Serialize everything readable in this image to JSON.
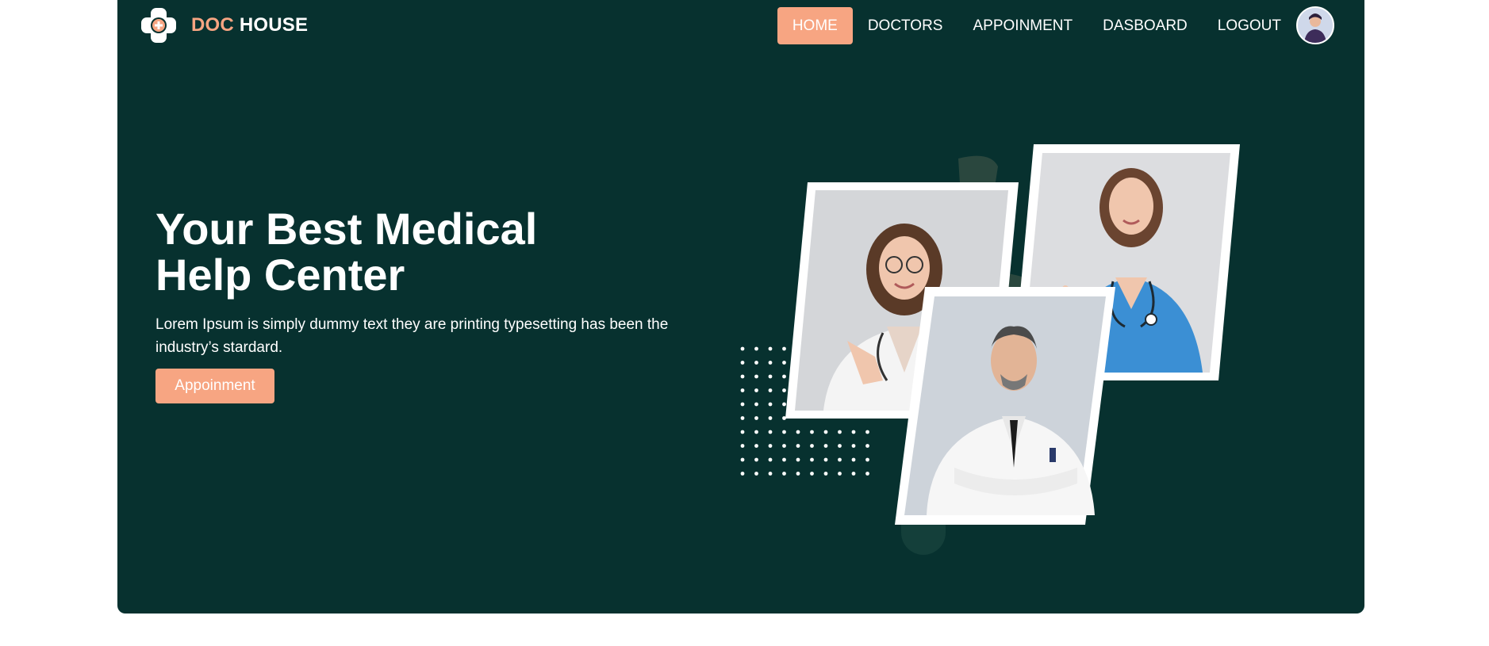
{
  "brand": {
    "part1": "DOC",
    "part2": "HOUSE",
    "logo_icon": "medical-cross-icon"
  },
  "nav": {
    "items": [
      {
        "label": "HOME",
        "active": true
      },
      {
        "label": "DOCTORS",
        "active": false
      },
      {
        "label": "APPOINMENT",
        "active": false
      },
      {
        "label": "DASBOARD",
        "active": false
      },
      {
        "label": "LOGOUT",
        "active": false
      }
    ],
    "avatar_icon": "user-avatar-icon"
  },
  "hero": {
    "title_line1": "Your Best Medical",
    "title_line2": "Help Center",
    "description": "Lorem Ipsum is simply dummy text they are printing typesetting has been the industry’s stardard.",
    "cta_label": "Appoinment"
  },
  "colors": {
    "background": "#07312f",
    "accent": "#f7a582",
    "text": "#ffffff"
  }
}
